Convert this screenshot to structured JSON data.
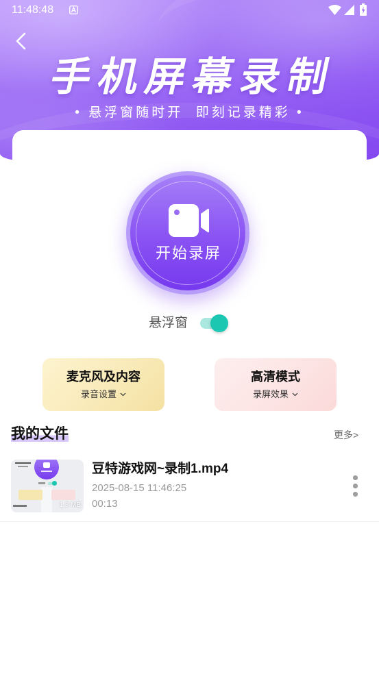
{
  "status_bar": {
    "time": "11:48:48",
    "icons": {
      "notification": "a-notification-icon",
      "wifi": "wifi-icon",
      "signal": "signal-icon",
      "battery": "battery-charging-icon"
    }
  },
  "header": {
    "back_icon": "chevron-left-icon",
    "title": "手机屏幕录制",
    "subtitle": "• 悬浮窗随时开  即刻记录精彩 •"
  },
  "record_button": {
    "icon": "video-camera-icon",
    "label": "开始录屏"
  },
  "floating_window": {
    "label": "悬浮窗",
    "enabled": true
  },
  "mode_cards": [
    {
      "title": "麦克风及内容",
      "subtitle": "录音设置",
      "icon": "chevron-down-icon"
    },
    {
      "title": "高清模式",
      "subtitle": "录屏效果",
      "icon": "chevron-down-icon"
    }
  ],
  "files_section": {
    "title": "我的文件",
    "more_label": "更多>"
  },
  "files": [
    {
      "name": "豆特游戏网~录制1.mp4",
      "date": "2025-08-15 11:46:25",
      "duration": "00:13",
      "thumbnail_size": "1.3 MB",
      "menu_icon": "more-vertical-icon"
    }
  ],
  "colors": {
    "header_purple": "#8d55f2",
    "button_purple": "#8a52f3",
    "toggle_teal": "#1cc7b2",
    "mic_card": "#f8e9b6",
    "hd_card": "#fde3e3",
    "heading_highlight": "#d9c8fc"
  }
}
